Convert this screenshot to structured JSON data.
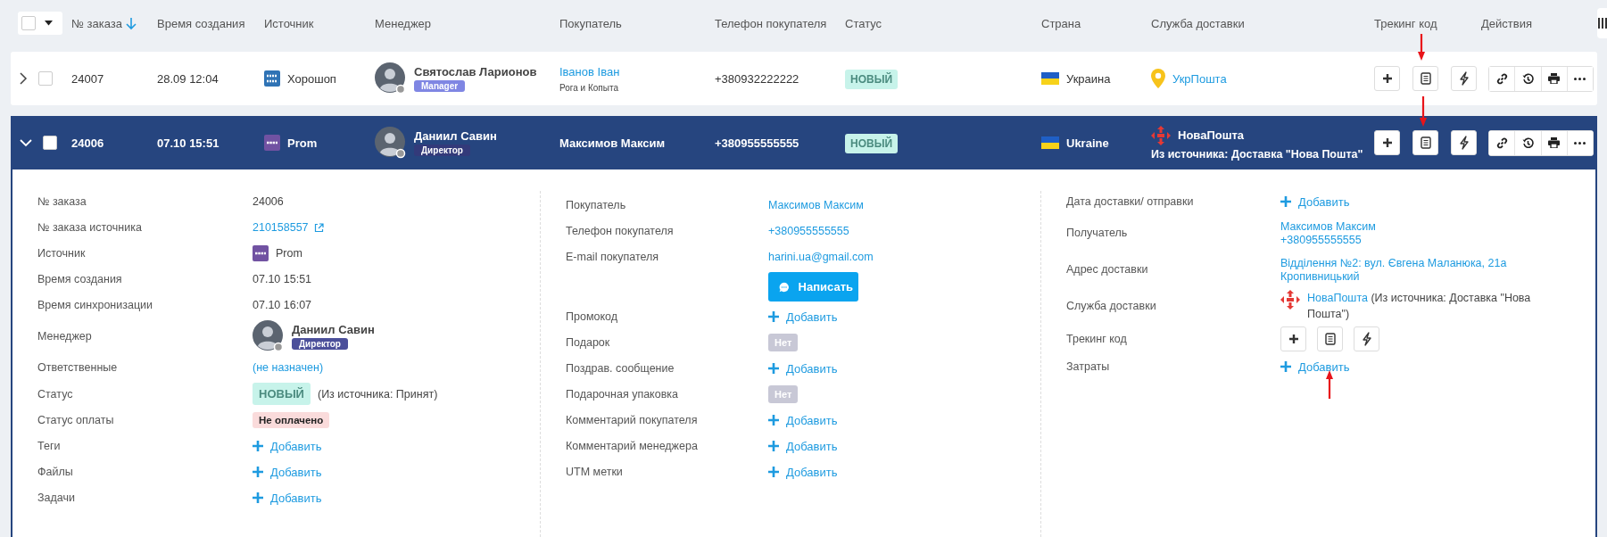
{
  "header": {
    "select_all": {
      "checked": false
    },
    "columns": [
      {
        "label": "№ заказа",
        "sorted": true
      },
      {
        "label": "Время создания",
        "sorted": false
      },
      {
        "label": "Источник",
        "sorted": false
      },
      {
        "label": "Менеджер",
        "sorted": false
      },
      {
        "label": "Покупатель",
        "sorted": false
      },
      {
        "label": "Телефон покупателя",
        "sorted": false
      },
      {
        "label": "Статус",
        "sorted": false
      },
      {
        "label": "Страна",
        "sorted": false
      },
      {
        "label": "Служба доставки",
        "sorted": false
      },
      {
        "label": "Трекинг код",
        "sorted": false
      },
      {
        "label": "Действия",
        "sorted": false
      }
    ]
  },
  "rows": [
    {
      "expanded": false,
      "checked": false,
      "order": "24007",
      "created": "28.09 12:04",
      "source": {
        "kind": "horoshop",
        "name": "Хорошоп"
      },
      "manager": {
        "name": "Святослав Ларионов",
        "role": "Manager",
        "color": "#7f86e3"
      },
      "buyer": {
        "name": "Іванов Іван",
        "company": "Рога и Копыта"
      },
      "phone": "+380932222222",
      "status": "НОВЫЙ",
      "country": "Украина",
      "delivery": {
        "kind": "ukrposhta",
        "name": "УкрПошта"
      }
    },
    {
      "expanded": true,
      "checked": false,
      "order": "24006",
      "created": "07.10 15:51",
      "source": {
        "kind": "prom",
        "name": "Prom"
      },
      "manager": {
        "name": "Даниил Савин",
        "role": "Директор",
        "color": "#333a7a"
      },
      "buyer": {
        "name": "Максимов Максим"
      },
      "phone": "+380955555555",
      "status": "НОВЫЙ",
      "country": "Ukraine",
      "delivery": {
        "kind": "novaposhta",
        "name": "НоваПошта",
        "note": "Из источника: Доставка \"Нова Пошта\""
      }
    }
  ],
  "detail": {
    "columns": [
      [
        {
          "label": "№ заказа",
          "kind": "text",
          "value": "24006"
        },
        {
          "label": "№ заказа источника",
          "kind": "external_link",
          "value": "210158557"
        },
        {
          "label": "Источник",
          "kind": "source",
          "value": "Prom"
        },
        {
          "label": "Время создания",
          "kind": "text",
          "value": "07.10 15:51"
        },
        {
          "label": "Время синхронизации",
          "kind": "text",
          "value": "07.10 16:07"
        },
        {
          "label": "Менеджер",
          "kind": "manager",
          "name": "Даниил Савин",
          "role": "Директор",
          "color": "#4b4f9a"
        },
        {
          "label": "Ответственные",
          "kind": "link",
          "value": "(не назначен)"
        },
        {
          "label": "Статус",
          "kind": "status",
          "value": "НОВЫЙ",
          "note": "(Из источника: Принят)"
        },
        {
          "label": "Статус оплаты",
          "kind": "payment",
          "value": "Не оплачено"
        },
        {
          "label": "Теги",
          "kind": "add",
          "value": "Добавить"
        },
        {
          "label": "Файлы",
          "kind": "add",
          "value": "Добавить"
        },
        {
          "label": "Задачи",
          "kind": "add",
          "value": "Добавить"
        }
      ],
      [
        {
          "label": "Покупатель",
          "kind": "link",
          "value": "Максимов Максим"
        },
        {
          "label": "Телефон покупателя",
          "kind": "link",
          "value": "+380955555555"
        },
        {
          "label": "E-mail покупателя",
          "kind": "link",
          "value": "harini.ua@gmail.com"
        },
        {
          "kind": "button",
          "value": "Написать"
        },
        {
          "label": "Промокод",
          "kind": "add",
          "value": "Добавить"
        },
        {
          "label": "Подарок",
          "kind": "flag",
          "value": "Нет"
        },
        {
          "label": "Поздрав. сообщение",
          "kind": "add",
          "value": "Добавить"
        },
        {
          "label": "Подарочная упаковка",
          "kind": "flag",
          "value": "Нет"
        },
        {
          "label": "Комментарий покупателя",
          "kind": "add",
          "value": "Добавить"
        },
        {
          "label": "Комментарий менеджера",
          "kind": "add",
          "value": "Добавить"
        },
        {
          "label": "UTM метки",
          "kind": "add",
          "value": "Добавить"
        }
      ],
      [
        {
          "label": "Дата доставки/ отправки",
          "kind": "add",
          "value": "Добавить"
        },
        {
          "label": "Получатель",
          "kind": "links",
          "lines": [
            "Максимов Максим",
            "+380955555555"
          ]
        },
        {
          "label": "Адрес доставки",
          "kind": "links",
          "lines": [
            "Відділення №2: вул. Євгена Маланюка, 21а",
            "Кропивницький"
          ]
        },
        {
          "label": "Служба доставки",
          "kind": "delivery",
          "name": "НоваПошта",
          "note": "(Из источника: Доставка \"Нова Пошта\")"
        },
        {
          "label": "Трекинг код",
          "kind": "tracking"
        },
        {
          "label": "Затраты",
          "kind": "add",
          "value": "Добавить"
        }
      ]
    ]
  }
}
